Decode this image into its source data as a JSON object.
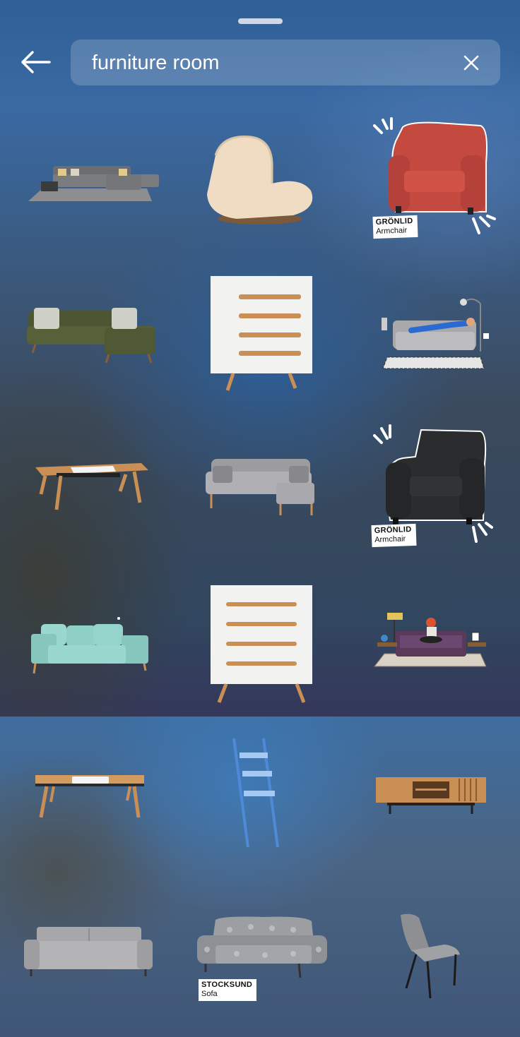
{
  "search": {
    "query": "furniture room"
  },
  "stickers": [
    {
      "name": "sectional-sofa-rug"
    },
    {
      "name": "boucle-lounge-chair"
    },
    {
      "name": "red-armchair",
      "tag_name": "GRÖNLID",
      "tag_type": "Armchair"
    },
    {
      "name": "green-sectional-sofa"
    },
    {
      "name": "white-dresser"
    },
    {
      "name": "person-on-sofa-scene"
    },
    {
      "name": "wood-coffee-table"
    },
    {
      "name": "grey-sectional-sofa"
    },
    {
      "name": "black-armchair",
      "tag_name": "GRÖNLID",
      "tag_type": "Armchair"
    },
    {
      "name": "mint-sofa"
    },
    {
      "name": "white-dresser-2"
    },
    {
      "name": "person-room-scene"
    },
    {
      "name": "wood-coffee-table-2"
    },
    {
      "name": "blue-ladder-shelf"
    },
    {
      "name": "wood-tv-console"
    },
    {
      "name": "grey-sofa"
    },
    {
      "name": "patterned-sofa",
      "tag_name": "STOCKSUND",
      "tag_type": "Sofa"
    },
    {
      "name": "grey-dining-chair"
    }
  ],
  "colors": {
    "red_armchair": "#c44a3f",
    "black_armchair": "#2b2c2e",
    "mint_sofa": "#8ecfc6",
    "green_sofa": "#4c5632",
    "wood": "#c98f55"
  }
}
